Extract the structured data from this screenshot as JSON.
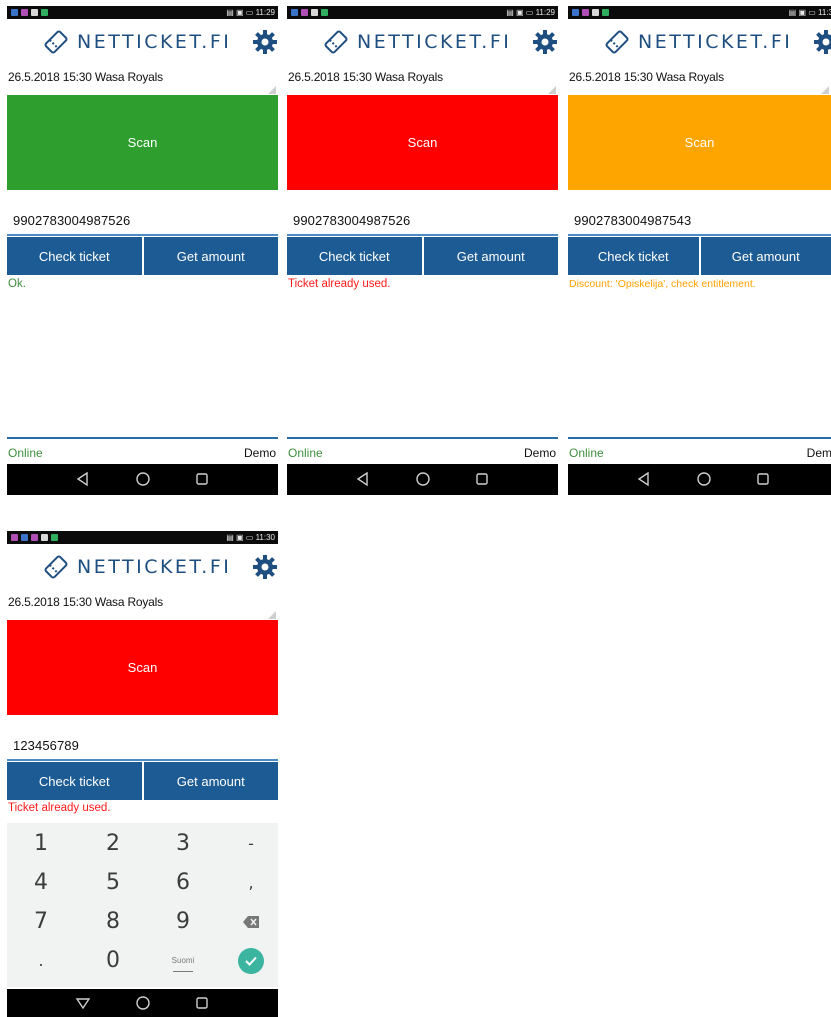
{
  "colors": {
    "brand_blue": "#1f4f80",
    "button_blue": "#1c5b93",
    "scan_green": "#2e9e2e",
    "scan_red": "#ff0000",
    "scan_orange": "#ffa500",
    "ok_green": "#3f8f3f",
    "error_red": "#ff1a1a",
    "warn_orange": "#ffa000",
    "enter_teal": "#3bb4a0"
  },
  "icons": {
    "logo": "ticket-icon",
    "settings": "gear-icon",
    "back": "back-triangle-icon",
    "home": "home-circle-icon",
    "recents": "recents-square-icon",
    "backspace": "backspace-icon",
    "done": "checkmark-icon"
  },
  "screens": [
    {
      "status_time": "11:29",
      "logo_text": "NETTICKET.FI",
      "event": "26.5.2018 15:30 Wasa Royals",
      "scan_label": "Scan",
      "scan_color": "#2e9e2e",
      "ticket_value": "9902783004987526",
      "check_label": "Check ticket",
      "amount_label": "Get amount",
      "message": "Ok.",
      "message_color": "#3f8f3f",
      "online_label": "Online",
      "mode_label": "Demo"
    },
    {
      "status_time": "11:29",
      "logo_text": "NETTICKET.FI",
      "event": "26.5.2018 15:30 Wasa Royals",
      "scan_label": "Scan",
      "scan_color": "#ff0000",
      "ticket_value": "9902783004987526",
      "check_label": "Check ticket",
      "amount_label": "Get amount",
      "message": "Ticket already used.",
      "message_color": "#ff1a1a",
      "online_label": "Online",
      "mode_label": "Demo"
    },
    {
      "status_time": "11:3",
      "logo_text": "NETTICKET.FI",
      "event": "26.5.2018 15:30 Wasa Royals",
      "scan_label": "Scan",
      "scan_color": "#ffa500",
      "ticket_value": "9902783004987543",
      "check_label": "Check ticket",
      "amount_label": "Get amount",
      "message": "Discount: 'Opiskelija', check entitlement.",
      "message_color": "#ffa000",
      "online_label": "Online",
      "mode_label": "Dem"
    },
    {
      "status_time": "11:30",
      "logo_text": "NETTICKET.FI",
      "event": "26.5.2018 15:30 Wasa Royals",
      "scan_label": "Scan",
      "scan_color": "#ff0000",
      "ticket_value": "123456789",
      "check_label": "Check ticket",
      "amount_label": "Get amount",
      "message": "Ticket already used.",
      "message_color": "#ff1a1a",
      "keypad": {
        "keys": [
          "1",
          "2",
          "3",
          "-",
          "4",
          "5",
          "6",
          ",",
          "7",
          "8",
          "9",
          ".",
          "0"
        ],
        "language_label": "Suomi"
      }
    }
  ]
}
